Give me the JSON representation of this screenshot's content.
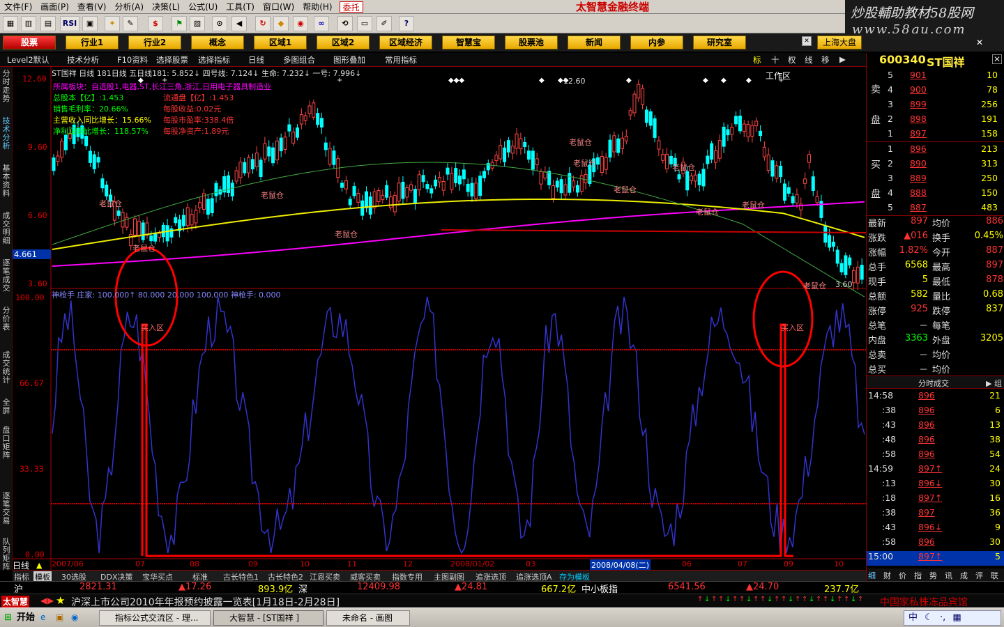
{
  "menu": [
    "文件(F)",
    "画面(P)",
    "查看(V)",
    "分析(A)",
    "决策(L)",
    "公式(U)",
    "工具(T)",
    "窗口(W)",
    "帮助(H)"
  ],
  "menu_entrust": "委托",
  "brand": "太智慧金融终端",
  "watermark": {
    "line1": "炒股輔助教材58股网",
    "line2": "www.58gu.com"
  },
  "toolbar_icons": [
    "grid-icon",
    "bar-chart-icon",
    "rsi-icon",
    "table-icon",
    "star-icon",
    "pencil-icon",
    "dollar-icon",
    "flag-icon",
    "binoculars-icon",
    "speaker-icon",
    "reload-icon",
    "diamond-icon",
    "cross-icon",
    "target-icon",
    "link-icon",
    "calendar-icon",
    "pen-icon",
    "help-cursor-icon"
  ],
  "toolbar_rsi": "RSI",
  "nav": [
    "股票",
    "行业1",
    "行业2",
    "概念",
    "区域1",
    "区域2",
    "区域经济",
    "智慧宝",
    "股票池",
    "新闻",
    "内参",
    "研究室"
  ],
  "workarea": "工作区",
  "market_select": "上海大盘",
  "tabrow": [
    "Level2默认",
    "技术分析",
    "F10资料",
    "选择股票",
    "选择指标",
    "日线",
    "多图组合",
    "图形叠加",
    "常用指标"
  ],
  "tabrow_right": [
    "标",
    "十",
    "权",
    "线",
    "移",
    "▶"
  ],
  "vtabs": [
    "分时走势",
    "技术分析",
    "基本资料",
    "成交明细",
    "逐笔成交",
    "分价表",
    "成交统计",
    "全屏",
    "盘口矩阵",
    "逐笔交易",
    "队列矩阵"
  ],
  "chart": {
    "header": "ST国祥  日线  181日线  五日线181: 5.852↓  四号线: 7.124↓  生命: 7.232↓  一号: 7.996↓",
    "info": [
      {
        "k": "所属板块：",
        "v": "自选股1,电器,ST,长江三角,浙江,日用电子器具制造业"
      },
      {
        "k": "总股本【亿】:",
        "v": "1.453"
      },
      {
        "k": "流通盘【亿】:",
        "v": "1.453"
      },
      {
        "k": "销售毛利率：",
        "v": "20.66%"
      },
      {
        "k": "每股收益:",
        "v": "0.02元"
      },
      {
        "k": "主营收入同比增长：",
        "v": "15.66%"
      },
      {
        "k": "每股市盈率:",
        "v": "338.4倍"
      },
      {
        "k": "净利润同比增长：",
        "v": "118.57%"
      },
      {
        "k": "每股净资产:",
        "v": "1.89元"
      }
    ],
    "price_axis": [
      "12.60",
      "9.60",
      "6.60",
      "3.60"
    ],
    "current_price": "4.661",
    "high_marker": "12.60",
    "low_marker": "3.60",
    "annotations": [
      "老鼠仓",
      "老鼠仓",
      "老鼠仓",
      "老鼠仓",
      "老鼠仓",
      "老鼠仓",
      "老鼠仓",
      "老鼠仓",
      "老鼠仓",
      "老鼠仓",
      "老鼠仓"
    ],
    "indicator_header": "神枪手  庄家: 100.000↑  80.000  20.000  100.000  神枪手: 0.000",
    "indicator_axis": [
      "100.00",
      "66.67",
      "33.33",
      "0.00"
    ],
    "buy_zone": "买入区",
    "xaxis": [
      "2007/06",
      "07",
      "08",
      "09",
      "10",
      "11",
      "12",
      "2008/01/02",
      "03",
      "04",
      "05",
      "06",
      "07",
      "08",
      "09",
      "10"
    ],
    "date_cursor": "2008/04/08(二)",
    "period": "日线"
  },
  "quote": {
    "code": "600340",
    "name": "ST国祥",
    "sell": [
      {
        "n": "5",
        "p": "901",
        "v": "10"
      },
      {
        "n": "4",
        "p": "900",
        "v": "78"
      },
      {
        "n": "3",
        "p": "899",
        "v": "256"
      },
      {
        "n": "2",
        "p": "898",
        "v": "191"
      },
      {
        "n": "1",
        "p": "897",
        "v": "158"
      }
    ],
    "buy": [
      {
        "n": "1",
        "p": "896",
        "v": "213"
      },
      {
        "n": "2",
        "p": "890",
        "v": "313"
      },
      {
        "n": "3",
        "p": "889",
        "v": "250"
      },
      {
        "n": "4",
        "p": "888",
        "v": "150"
      },
      {
        "n": "5",
        "p": "887",
        "v": "483"
      }
    ],
    "sell_label": [
      "卖",
      "盘"
    ],
    "buy_label": [
      "买",
      "盘"
    ],
    "stats": [
      {
        "a": "最新",
        "b": "897",
        "c": "均价",
        "d": "886"
      },
      {
        "a": "涨跌",
        "b": "▲016",
        "c": "换手",
        "d": "0.45%"
      },
      {
        "a": "涨幅",
        "b": "1.82%",
        "c": "今开",
        "d": "887"
      },
      {
        "a": "总手",
        "b": "6568",
        "c": "最高",
        "d": "897"
      },
      {
        "a": "现手",
        "b": "5",
        "c": "最低",
        "d": "878"
      },
      {
        "a": "总额",
        "b": "582",
        "c": "量比",
        "d": "0.68"
      },
      {
        "a": "涨停",
        "b": "925",
        "c": "跌停",
        "d": "837"
      },
      {
        "a": "总笔",
        "b": "－",
        "c": "每笔",
        "d": ""
      },
      {
        "a": "内盘",
        "b": "3363",
        "c": "外盘",
        "d": "3205"
      },
      {
        "a": "总卖",
        "b": "－",
        "c": "均价",
        "d": ""
      },
      {
        "a": "总买",
        "b": "－",
        "c": "均价",
        "d": ""
      }
    ],
    "ticks_title": "分时成交",
    "ticks_btn": "▶ 组",
    "ticks": [
      {
        "t": "14:58",
        "p": "896",
        "v": "21"
      },
      {
        "t": ":38",
        "p": "896",
        "v": "6"
      },
      {
        "t": ":43",
        "p": "896",
        "v": "13"
      },
      {
        "t": ":48",
        "p": "896",
        "v": "38"
      },
      {
        "t": ":58",
        "p": "896",
        "v": "54"
      },
      {
        "t": "14:59",
        "p": "897↑",
        "v": "24"
      },
      {
        "t": ":13",
        "p": "896↓",
        "v": "30"
      },
      {
        "t": ":18",
        "p": "897↑",
        "v": "16"
      },
      {
        "t": ":38",
        "p": "897",
        "v": "36"
      },
      {
        "t": ":43",
        "p": "896↓",
        "v": "9"
      },
      {
        "t": ":58",
        "p": "896",
        "v": "30"
      },
      {
        "t": "15:00",
        "p": "897↑",
        "v": "5"
      }
    ],
    "bottom_tabs": [
      "细",
      "财",
      "价",
      "指",
      "势",
      "讯",
      "成",
      "评",
      "联"
    ]
  },
  "btabs": [
    "指标",
    "模板",
    "30选股",
    "DDX决策",
    "宝华买点",
    "标准",
    "古长特色1",
    "古长特色2",
    "江恩买卖",
    "威客买卖",
    "指数专用",
    "主图副图",
    "追涨选顶",
    "追涨选顶A",
    "存为模板"
  ],
  "index_bar": [
    {
      "t": "沪",
      "c": "#fff"
    },
    {
      "t": "2821.31",
      "c": "#f33"
    },
    {
      "t": "▲17.26",
      "c": "#f33"
    },
    {
      "t": "893.9亿",
      "c": "#ff0"
    },
    {
      "t": "深",
      "c": "#fff"
    },
    {
      "t": "12409.98",
      "c": "#f33"
    },
    {
      "t": "▲24.81",
      "c": "#f33"
    },
    {
      "t": "667.2亿",
      "c": "#ff0"
    },
    {
      "t": "中小板指",
      "c": "#fff"
    },
    {
      "t": "6541.56",
      "c": "#f33"
    },
    {
      "t": "▲24.70",
      "c": "#f33"
    },
    {
      "t": "237.7亿",
      "c": "#ff0"
    }
  ],
  "news": {
    "logo": "太智慧",
    "text": "沪深上市公司2010年年报预约披露一览表[1月18日-2月28日]",
    "right": "中国家私株冻品宾馆"
  },
  "taskbar": {
    "start": "开始",
    "items": [
      "指标公式交流区 - 理...",
      "大智慧 - [ST国祥 ]",
      "未命名 - 画图"
    ],
    "ime": "中"
  }
}
